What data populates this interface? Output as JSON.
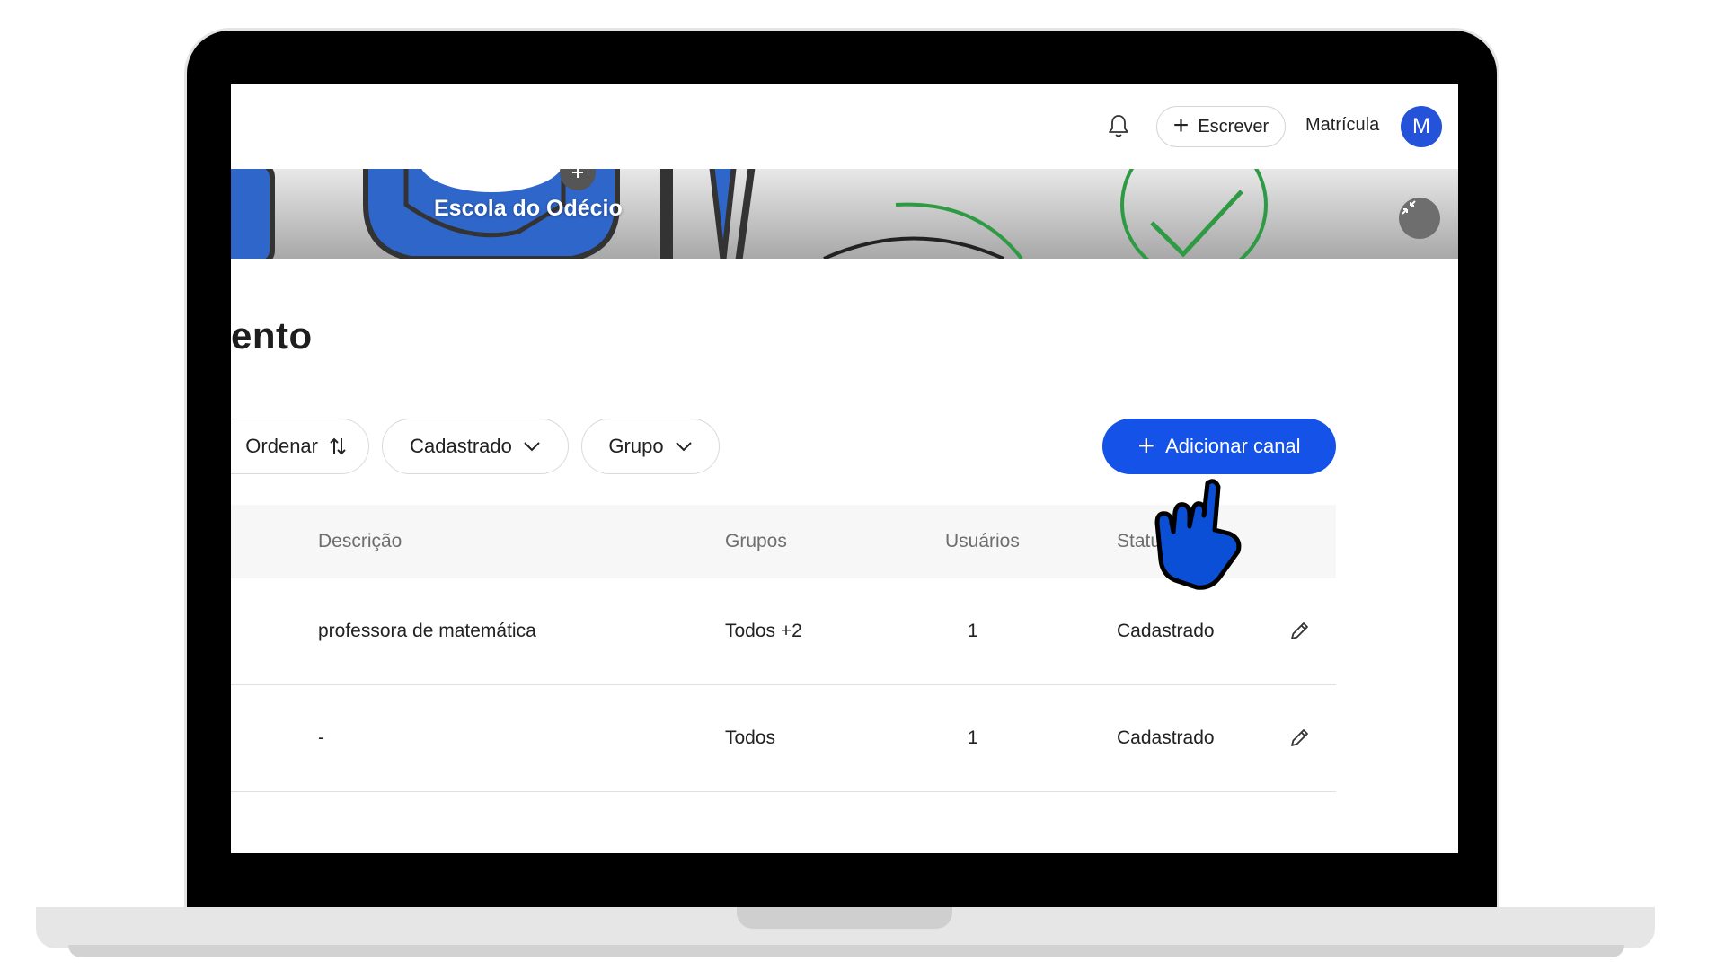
{
  "topbar": {
    "write_label": "Escrever",
    "account_label": "Matrícula",
    "avatar_initial": "M"
  },
  "banner": {
    "school_name": "Escola do Odécio"
  },
  "page": {
    "heading": "ento"
  },
  "filters": {
    "sort_label": "Ordenar",
    "status_label": "Cadastrado",
    "group_label": "Grupo"
  },
  "actions": {
    "add_channel_label": "Adicionar canal"
  },
  "table": {
    "headers": {
      "description": "Descrição",
      "groups": "Grupos",
      "users": "Usuários",
      "status": "Status"
    },
    "rows": [
      {
        "description": "professora de matemática",
        "groups": "Todos +2",
        "users": "1",
        "status": "Cadastrado"
      },
      {
        "description": "-",
        "groups": "Todos",
        "users": "1",
        "status": "Cadastrado"
      }
    ]
  },
  "colors": {
    "accent": "#1552e8",
    "avatar": "#2452d8",
    "cursor": "#0b4fd6"
  }
}
